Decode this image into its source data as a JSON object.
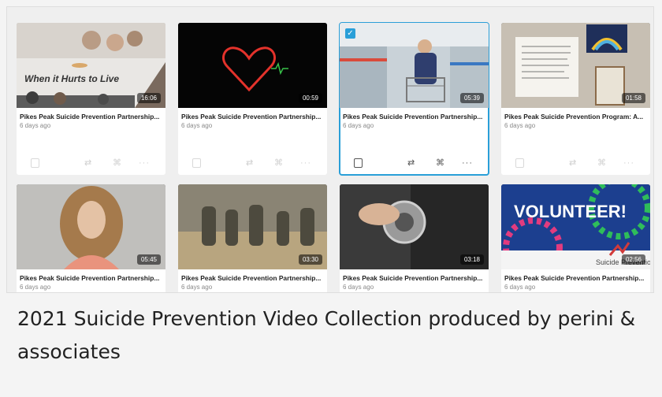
{
  "cards": [
    {
      "title": "Pikes Peak Suicide Prevention Partnership...",
      "age": "6 days ago",
      "duration": "16:06",
      "overlay_text": "When it Hurts to Live",
      "selected": false
    },
    {
      "title": "Pikes Peak Suicide Prevention Partnership...",
      "age": "6 days ago",
      "duration": "00:59",
      "selected": false
    },
    {
      "title": "Pikes Peak Suicide Prevention Partnership...",
      "age": "6 days ago",
      "duration": "05:39",
      "selected": true
    },
    {
      "title": "Pikes Peak Suicide Prevention Program: A...",
      "age": "6 days ago",
      "duration": "01:58",
      "selected": false
    },
    {
      "title": "Pikes Peak Suicide Prevention Partnership...",
      "age": "6 days ago",
      "duration": "05:45",
      "selected": false
    },
    {
      "title": "Pikes Peak Suicide Prevention Partnership...",
      "age": "6 days ago",
      "duration": "03:30",
      "selected": false
    },
    {
      "title": "Pikes Peak Suicide Prevention Partnership...",
      "age": "6 days ago",
      "duration": "03:18",
      "selected": false
    },
    {
      "title": "Pikes Peak Suicide Prevention Partnership...",
      "age": "6 days ago",
      "duration": "02:56",
      "overlay_text": "VOLUNTEER!",
      "overlay_text_2": "Suicide Prevention",
      "selected": false
    }
  ],
  "actions": {
    "edit": "edit-icon",
    "replace": "⇄",
    "link": "🔗",
    "more": "···"
  },
  "caption": "2021 Suicide Prevention Video Collection produced by perini & associates",
  "colors": {
    "selected_border": "#2a9fd8"
  }
}
